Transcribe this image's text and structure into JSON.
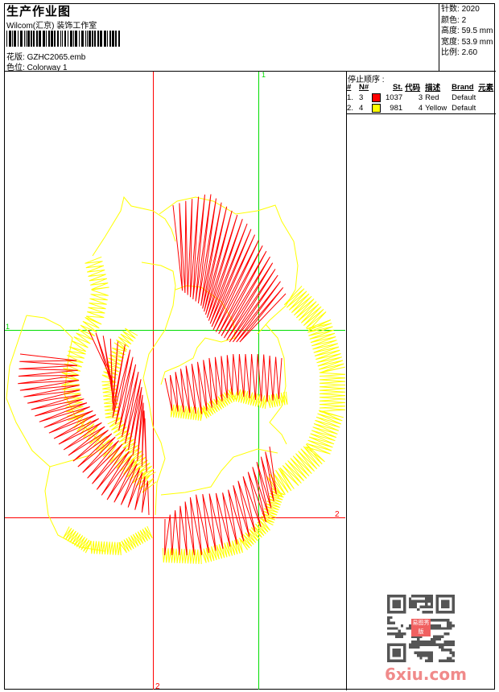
{
  "header": {
    "title": "生产作业图",
    "studio": "Wilcom(汇京) 装饰工作室",
    "design_label": "花版:",
    "design_value": "GZHC2065.emb",
    "colorway_label": "色位:",
    "colorway_value": "Colorway 1"
  },
  "stats": {
    "stitches_label": "针数:",
    "stitches": "2020",
    "colors_label": "颜色:",
    "colors": "2",
    "height_label": "高度:",
    "height": "59.5 mm",
    "width_label": "宽度:",
    "width": "53.9 mm",
    "scale_label": "比例:",
    "scale": "2.60"
  },
  "stop_sequence": {
    "title": "停止顺序 :",
    "columns": [
      "#",
      "N#",
      "St.",
      "代码",
      "描述",
      "Brand",
      "元素"
    ],
    "rows": [
      {
        "index": "1.",
        "needle": "3",
        "color": "#ff0000",
        "stitches": "1037",
        "code": "3",
        "description": "Red",
        "brand": "Default",
        "element": ""
      },
      {
        "index": "2.",
        "needle": "4",
        "color": "#ffff00",
        "stitches": "981",
        "code": "4",
        "description": "Yellow",
        "brand": "Default",
        "element": ""
      }
    ]
  },
  "grid_markers": {
    "marker_1": "1",
    "marker_2": "2",
    "color_1": "#00dd00",
    "color_2": "#ff0000"
  },
  "watermark": {
    "text": "6xiu.com",
    "stamp_text": "易图秀版"
  }
}
